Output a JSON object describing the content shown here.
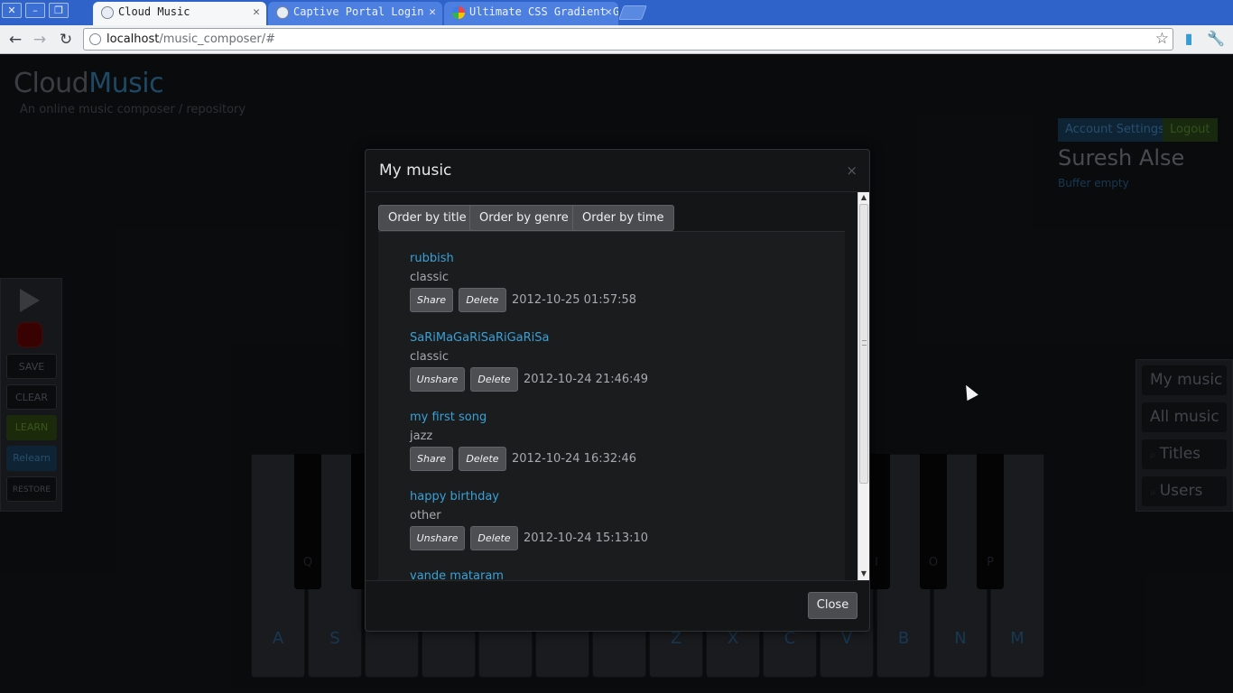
{
  "browser": {
    "tabs": [
      {
        "title": "Cloud Music",
        "active": true
      },
      {
        "title": "Captive Portal Login",
        "active": false
      },
      {
        "title": "Ultimate CSS Gradient Ge",
        "active": false
      }
    ],
    "url_host": "localhost",
    "url_path": "/music_composer/#"
  },
  "header": {
    "brand_part1": "Cloud",
    "brand_part2": "Music",
    "tagline": "An online music composer / repository"
  },
  "account": {
    "settings_label": "Account Settings",
    "logout_label": "Logout",
    "username": "Suresh Alse",
    "buffer_status": "Buffer empty"
  },
  "left_panel": {
    "save_label": "SAVE",
    "clear_label": "CLEAR",
    "learn_label": "LEARN",
    "relearn_label": "Relearn",
    "restore_label": "RESTORE"
  },
  "right_panel": {
    "my_music_label": "My music",
    "all_music_label": "All music",
    "titles_label": "Titles",
    "users_label": "Users"
  },
  "piano": {
    "white_keys": [
      "A",
      "S",
      "",
      "",
      "",
      "",
      "",
      "Z",
      "X",
      "C",
      "V",
      "B",
      "N",
      "M"
    ],
    "black_keys": [
      "Q",
      "",
      "I",
      "O",
      "P"
    ]
  },
  "modal": {
    "title": "My music",
    "close_x": "×",
    "sort_buttons": [
      "Order by title",
      "Order by genre",
      "Order by time"
    ],
    "songs": [
      {
        "title": "rubbish",
        "genre": "classic",
        "share_label": "Share",
        "delete_label": "Delete",
        "timestamp": "2012-10-25 01:57:58"
      },
      {
        "title": "SaRiMaGaRiSaRiGaRiSa",
        "genre": "classic",
        "share_label": "Unshare",
        "delete_label": "Delete",
        "timestamp": "2012-10-24 21:46:49"
      },
      {
        "title": "my first song",
        "genre": "jazz",
        "share_label": "Share",
        "delete_label": "Delete",
        "timestamp": "2012-10-24 16:32:46"
      },
      {
        "title": "happy birthday",
        "genre": "other",
        "share_label": "Unshare",
        "delete_label": "Delete",
        "timestamp": "2012-10-24 15:13:10"
      },
      {
        "title": "vande mataram"
      }
    ],
    "close_label": "Close"
  }
}
